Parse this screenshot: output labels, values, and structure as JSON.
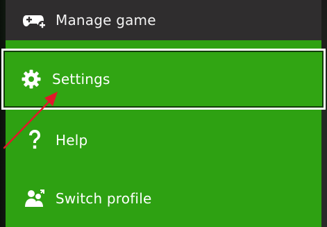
{
  "menu": {
    "items": [
      {
        "label": "Manage game",
        "icon": "controller-plus-icon"
      },
      {
        "label": "Settings",
        "icon": "gear-icon"
      },
      {
        "label": "Help",
        "icon": "question-mark-icon"
      },
      {
        "label": "Switch profile",
        "icon": "switch-profile-icon"
      }
    ],
    "selected_index": 1
  },
  "colors": {
    "menu_green": "#2ea112",
    "selected_green": "#31a513",
    "dark_item": "#2f2d2e",
    "annotation_arrow": "#e0182a",
    "focus_border": "#ffffff"
  }
}
